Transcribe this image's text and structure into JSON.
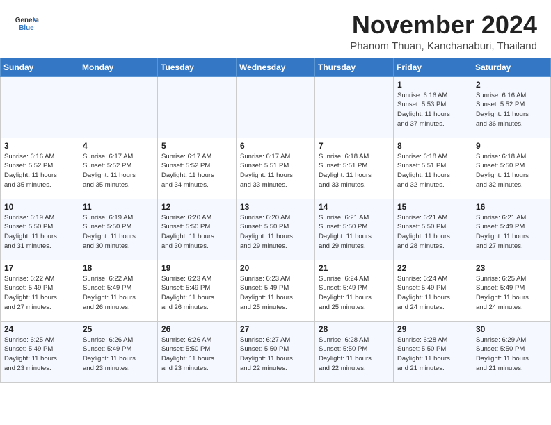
{
  "header": {
    "logo_line1": "General",
    "logo_line2": "Blue",
    "month_title": "November 2024",
    "subtitle": "Phanom Thuan, Kanchanaburi, Thailand"
  },
  "weekdays": [
    "Sunday",
    "Monday",
    "Tuesday",
    "Wednesday",
    "Thursday",
    "Friday",
    "Saturday"
  ],
  "weeks": [
    [
      {
        "day": "",
        "info": ""
      },
      {
        "day": "",
        "info": ""
      },
      {
        "day": "",
        "info": ""
      },
      {
        "day": "",
        "info": ""
      },
      {
        "day": "",
        "info": ""
      },
      {
        "day": "1",
        "info": "Sunrise: 6:16 AM\nSunset: 5:53 PM\nDaylight: 11 hours\nand 37 minutes."
      },
      {
        "day": "2",
        "info": "Sunrise: 6:16 AM\nSunset: 5:52 PM\nDaylight: 11 hours\nand 36 minutes."
      }
    ],
    [
      {
        "day": "3",
        "info": "Sunrise: 6:16 AM\nSunset: 5:52 PM\nDaylight: 11 hours\nand 35 minutes."
      },
      {
        "day": "4",
        "info": "Sunrise: 6:17 AM\nSunset: 5:52 PM\nDaylight: 11 hours\nand 35 minutes."
      },
      {
        "day": "5",
        "info": "Sunrise: 6:17 AM\nSunset: 5:52 PM\nDaylight: 11 hours\nand 34 minutes."
      },
      {
        "day": "6",
        "info": "Sunrise: 6:17 AM\nSunset: 5:51 PM\nDaylight: 11 hours\nand 33 minutes."
      },
      {
        "day": "7",
        "info": "Sunrise: 6:18 AM\nSunset: 5:51 PM\nDaylight: 11 hours\nand 33 minutes."
      },
      {
        "day": "8",
        "info": "Sunrise: 6:18 AM\nSunset: 5:51 PM\nDaylight: 11 hours\nand 32 minutes."
      },
      {
        "day": "9",
        "info": "Sunrise: 6:18 AM\nSunset: 5:50 PM\nDaylight: 11 hours\nand 32 minutes."
      }
    ],
    [
      {
        "day": "10",
        "info": "Sunrise: 6:19 AM\nSunset: 5:50 PM\nDaylight: 11 hours\nand 31 minutes."
      },
      {
        "day": "11",
        "info": "Sunrise: 6:19 AM\nSunset: 5:50 PM\nDaylight: 11 hours\nand 30 minutes."
      },
      {
        "day": "12",
        "info": "Sunrise: 6:20 AM\nSunset: 5:50 PM\nDaylight: 11 hours\nand 30 minutes."
      },
      {
        "day": "13",
        "info": "Sunrise: 6:20 AM\nSunset: 5:50 PM\nDaylight: 11 hours\nand 29 minutes."
      },
      {
        "day": "14",
        "info": "Sunrise: 6:21 AM\nSunset: 5:50 PM\nDaylight: 11 hours\nand 29 minutes."
      },
      {
        "day": "15",
        "info": "Sunrise: 6:21 AM\nSunset: 5:50 PM\nDaylight: 11 hours\nand 28 minutes."
      },
      {
        "day": "16",
        "info": "Sunrise: 6:21 AM\nSunset: 5:49 PM\nDaylight: 11 hours\nand 27 minutes."
      }
    ],
    [
      {
        "day": "17",
        "info": "Sunrise: 6:22 AM\nSunset: 5:49 PM\nDaylight: 11 hours\nand 27 minutes."
      },
      {
        "day": "18",
        "info": "Sunrise: 6:22 AM\nSunset: 5:49 PM\nDaylight: 11 hours\nand 26 minutes."
      },
      {
        "day": "19",
        "info": "Sunrise: 6:23 AM\nSunset: 5:49 PM\nDaylight: 11 hours\nand 26 minutes."
      },
      {
        "day": "20",
        "info": "Sunrise: 6:23 AM\nSunset: 5:49 PM\nDaylight: 11 hours\nand 25 minutes."
      },
      {
        "day": "21",
        "info": "Sunrise: 6:24 AM\nSunset: 5:49 PM\nDaylight: 11 hours\nand 25 minutes."
      },
      {
        "day": "22",
        "info": "Sunrise: 6:24 AM\nSunset: 5:49 PM\nDaylight: 11 hours\nand 24 minutes."
      },
      {
        "day": "23",
        "info": "Sunrise: 6:25 AM\nSunset: 5:49 PM\nDaylight: 11 hours\nand 24 minutes."
      }
    ],
    [
      {
        "day": "24",
        "info": "Sunrise: 6:25 AM\nSunset: 5:49 PM\nDaylight: 11 hours\nand 23 minutes."
      },
      {
        "day": "25",
        "info": "Sunrise: 6:26 AM\nSunset: 5:49 PM\nDaylight: 11 hours\nand 23 minutes."
      },
      {
        "day": "26",
        "info": "Sunrise: 6:26 AM\nSunset: 5:50 PM\nDaylight: 11 hours\nand 23 minutes."
      },
      {
        "day": "27",
        "info": "Sunrise: 6:27 AM\nSunset: 5:50 PM\nDaylight: 11 hours\nand 22 minutes."
      },
      {
        "day": "28",
        "info": "Sunrise: 6:28 AM\nSunset: 5:50 PM\nDaylight: 11 hours\nand 22 minutes."
      },
      {
        "day": "29",
        "info": "Sunrise: 6:28 AM\nSunset: 5:50 PM\nDaylight: 11 hours\nand 21 minutes."
      },
      {
        "day": "30",
        "info": "Sunrise: 6:29 AM\nSunset: 5:50 PM\nDaylight: 11 hours\nand 21 minutes."
      }
    ]
  ]
}
